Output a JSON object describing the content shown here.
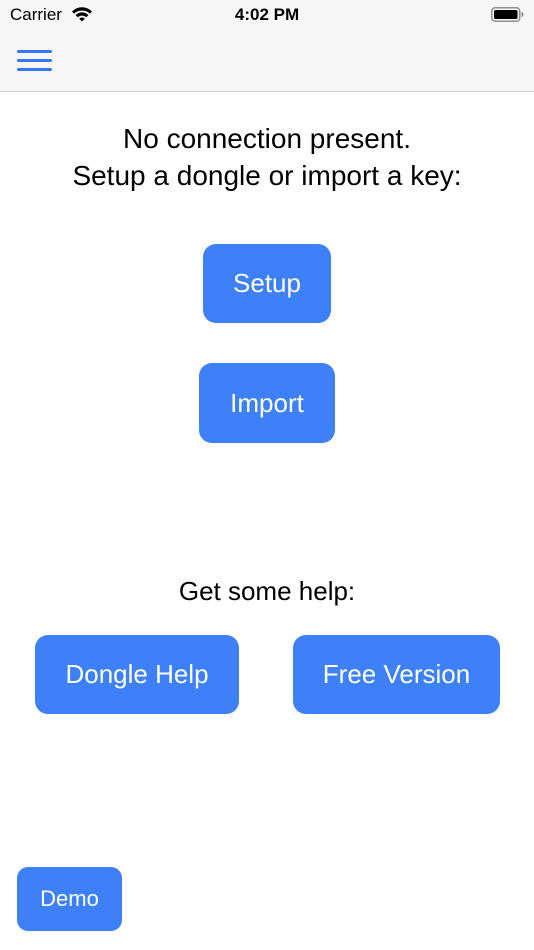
{
  "status_bar": {
    "carrier": "Carrier",
    "time": "4:02 PM",
    "wifi_icon": "wifi-icon",
    "battery_icon": "battery-icon"
  },
  "nav": {
    "menu_icon": "hamburger-menu-icon"
  },
  "main": {
    "message_line1": "No connection present.",
    "message_line2": "Setup a dongle or import a key:",
    "setup_label": "Setup",
    "import_label": "Import",
    "help_label": "Get some help:",
    "dongle_help_label": "Dongle Help",
    "free_version_label": "Free Version",
    "demo_label": "Demo"
  },
  "colors": {
    "accent": "#3478f6",
    "button_background": "#3d80f7",
    "bar_background": "#f6f6f6"
  }
}
